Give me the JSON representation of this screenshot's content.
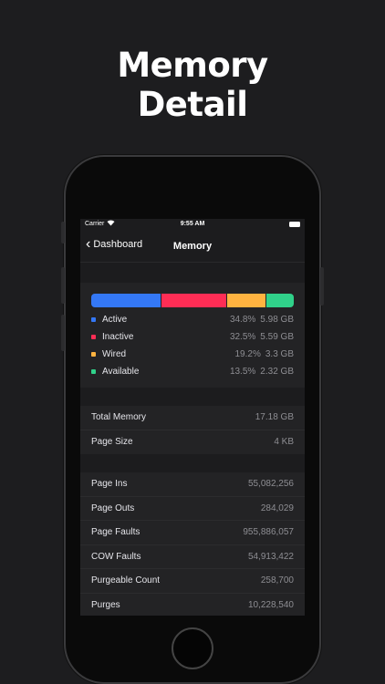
{
  "headline": {
    "line1": "Memory",
    "line2": "Detail"
  },
  "status": {
    "carrier": "Carrier",
    "time": "9:55 AM"
  },
  "nav": {
    "back_label": "Dashboard",
    "title": "Memory"
  },
  "memory_bar": {
    "segments": [
      {
        "name": "Active",
        "fraction": 0.348,
        "color": "#3478f6"
      },
      {
        "name": "Inactive",
        "fraction": 0.325,
        "color": "#ff2d55"
      },
      {
        "name": "Wired",
        "fraction": 0.192,
        "color": "#ffb340"
      },
      {
        "name": "Available",
        "fraction": 0.135,
        "color": "#30d18a"
      }
    ]
  },
  "legend": [
    {
      "name": "Active",
      "pct": "34.8%",
      "value": "5.98 GB"
    },
    {
      "name": "Inactive",
      "pct": "32.5%",
      "value": "5.59 GB"
    },
    {
      "name": "Wired",
      "pct": "19.2%",
      "value": "3.3 GB"
    },
    {
      "name": "Available",
      "pct": "13.5%",
      "value": "2.32 GB"
    }
  ],
  "totals": [
    {
      "label": "Total Memory",
      "value": "17.18 GB"
    },
    {
      "label": "Page Size",
      "value": "4 KB"
    }
  ],
  "stats": [
    {
      "label": "Page Ins",
      "value": "55,082,256"
    },
    {
      "label": "Page Outs",
      "value": "284,029"
    },
    {
      "label": "Page Faults",
      "value": "955,886,057"
    },
    {
      "label": "COW Faults",
      "value": "54,913,422"
    },
    {
      "label": "Purgeable Count",
      "value": "258,700"
    },
    {
      "label": "Purges",
      "value": "10,228,540"
    }
  ]
}
